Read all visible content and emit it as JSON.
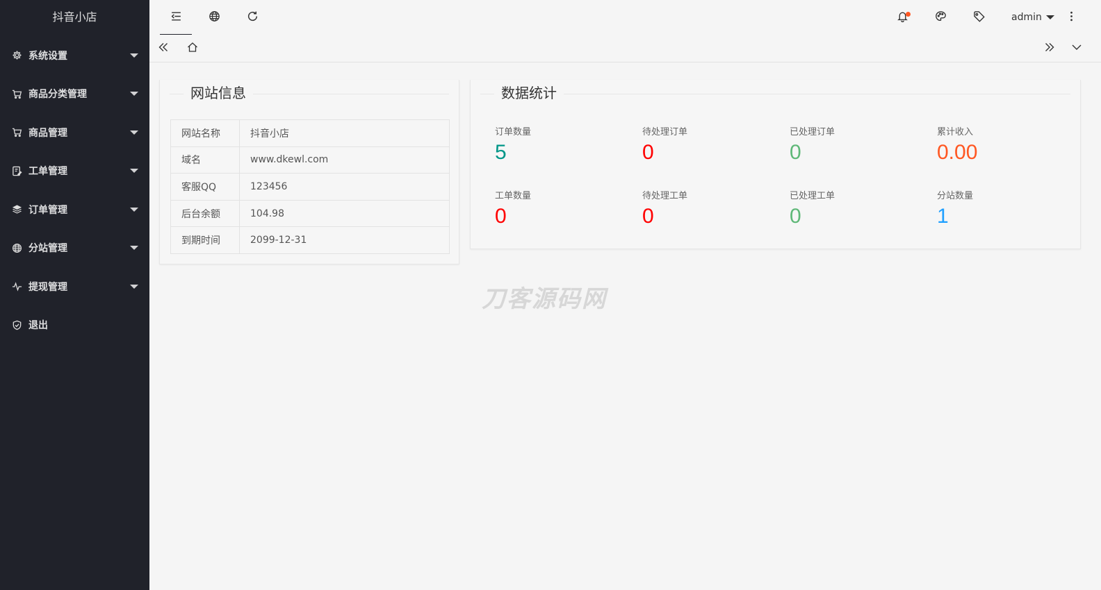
{
  "app": {
    "title": "抖音小店"
  },
  "sidebar": {
    "items": [
      {
        "label": "系统设置",
        "icon": "gear-icon",
        "has_caret": true
      },
      {
        "label": "商品分类管理",
        "icon": "cart-icon",
        "has_caret": true
      },
      {
        "label": "商品管理",
        "icon": "cart-icon",
        "has_caret": true
      },
      {
        "label": "工单管理",
        "icon": "ticket-icon",
        "has_caret": true
      },
      {
        "label": "订单管理",
        "icon": "layers-icon",
        "has_caret": true
      },
      {
        "label": "分站管理",
        "icon": "globe-icon",
        "has_caret": true
      },
      {
        "label": "提现管理",
        "icon": "pulse-icon",
        "has_caret": true
      },
      {
        "label": "退出",
        "icon": "shield-check-icon",
        "has_caret": false
      }
    ]
  },
  "header": {
    "user": "admin",
    "icons": [
      "menu-collapse-icon",
      "globe-icon",
      "refresh-icon",
      "bell-icon",
      "palette-icon",
      "tag-icon",
      "more-vertical-icon"
    ]
  },
  "site_info": {
    "title": "网站信息",
    "rows": [
      {
        "key": "网站名称",
        "value": "抖音小店"
      },
      {
        "key": "域名",
        "value": "www.dkewl.com"
      },
      {
        "key": "客服QQ",
        "value": "123456"
      },
      {
        "key": "后台余额",
        "value": "104.98"
      },
      {
        "key": "到期时间",
        "value": "2099-12-31"
      }
    ]
  },
  "stats": {
    "title": "数据统计",
    "items": [
      {
        "label": "订单数量",
        "value": "5",
        "color": "#009688"
      },
      {
        "label": "待处理订单",
        "value": "0",
        "color": "#ff0000"
      },
      {
        "label": "已处理订单",
        "value": "0",
        "color": "#5fb878"
      },
      {
        "label": "累计收入",
        "value": "0.00",
        "color": "#ff5722"
      },
      {
        "label": "工单数量",
        "value": "0",
        "color": "#ff0000"
      },
      {
        "label": "待处理工单",
        "value": "0",
        "color": "#ff0000"
      },
      {
        "label": "已处理工单",
        "value": "0",
        "color": "#5fb878"
      },
      {
        "label": "分站数量",
        "value": "1",
        "color": "#1e9fff"
      }
    ]
  },
  "watermark": "刀客源码网",
  "colors": {
    "sidebar_bg": "#20222a",
    "accent_dot": "#ff5722"
  }
}
